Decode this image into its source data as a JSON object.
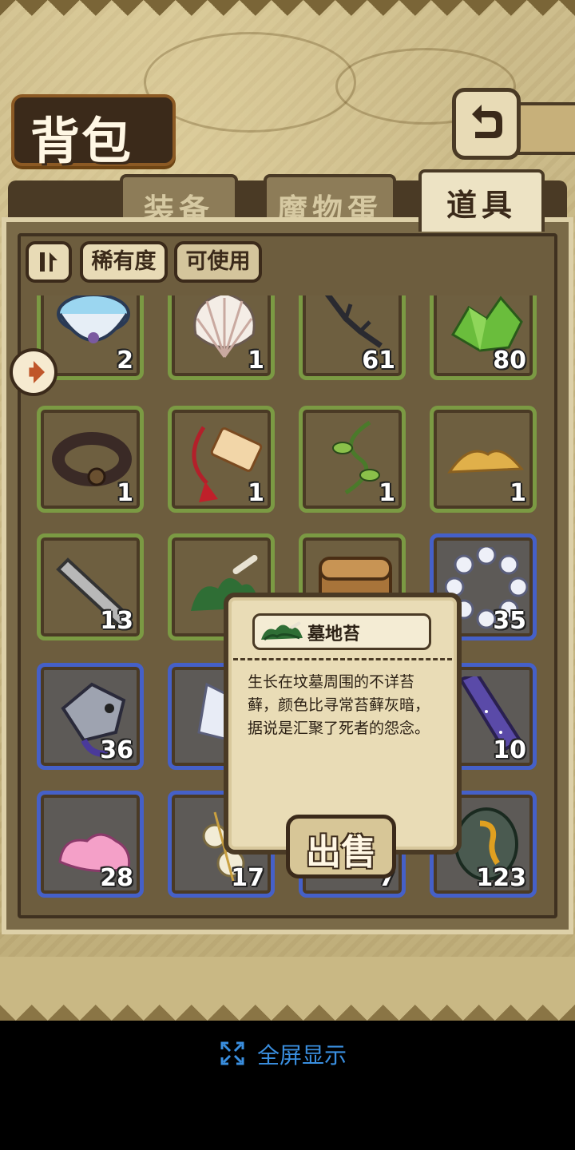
{
  "header": {
    "title": "背包",
    "back_icon": "back-arrow-icon"
  },
  "tabs": [
    {
      "label": "装备",
      "active": false
    },
    {
      "label": "魔物蛋",
      "active": false
    },
    {
      "label": "道具",
      "active": true
    }
  ],
  "toolbar": {
    "sort_icon": "sort-toggle-icon",
    "rarity_label": "稀有度",
    "usable_label": "可使用"
  },
  "items": [
    {
      "icon": "water-bowl-icon",
      "qty": "2",
      "rarity": "green"
    },
    {
      "icon": "shell-icon",
      "qty": "1",
      "rarity": "green"
    },
    {
      "icon": "dark-twig-icon",
      "qty": "61",
      "rarity": "green"
    },
    {
      "icon": "green-crystal-icon",
      "qty": "80",
      "rarity": "green"
    },
    {
      "icon": "leather-belt-icon",
      "qty": "1",
      "rarity": "green"
    },
    {
      "icon": "charm-tag-icon",
      "qty": "1",
      "rarity": "green"
    },
    {
      "icon": "vine-icon",
      "qty": "1",
      "rarity": "green"
    },
    {
      "icon": "sand-pile-icon",
      "qty": "1",
      "rarity": "green"
    },
    {
      "icon": "stone-pillar-icon",
      "qty": "13",
      "rarity": "green"
    },
    {
      "icon": "grave-moss-icon",
      "qty": "",
      "rarity": "green"
    },
    {
      "icon": "treasure-chest-icon",
      "qty": "",
      "rarity": "green"
    },
    {
      "icon": "pearl-bracelet-icon",
      "qty": "35",
      "rarity": "blue"
    },
    {
      "icon": "armored-fish-icon",
      "qty": "36",
      "rarity": "blue"
    },
    {
      "icon": "crystal-shard-icon",
      "qty": "",
      "rarity": "blue"
    },
    {
      "icon": "hidden-item-icon",
      "qty": "",
      "rarity": "blue"
    },
    {
      "icon": "starry-crystal-icon",
      "qty": "10",
      "rarity": "blue"
    },
    {
      "icon": "pink-slime-icon",
      "qty": "28",
      "rarity": "blue"
    },
    {
      "icon": "bone-charm-icon",
      "qty": "17",
      "rarity": "blue"
    },
    {
      "icon": "hidden-item-icon",
      "qty": "7",
      "rarity": "blue"
    },
    {
      "icon": "rune-stone-icon",
      "qty": "123",
      "rarity": "blue"
    }
  ],
  "popup": {
    "item_name": "墓地苔",
    "item_icon": "grave-moss-icon",
    "description": "生长在坟墓周围的不详苔藓，颜色比寻常苔藓灰暗，据说是汇聚了死者的怨念。",
    "sell_label": "出售"
  },
  "footer": {
    "fullscreen_label": "全屏显示",
    "fullscreen_icon": "expand-icon"
  },
  "colors": {
    "common_border": "#7b9a43",
    "rare_border": "#4560c8",
    "panel": "#6d5d3e"
  }
}
